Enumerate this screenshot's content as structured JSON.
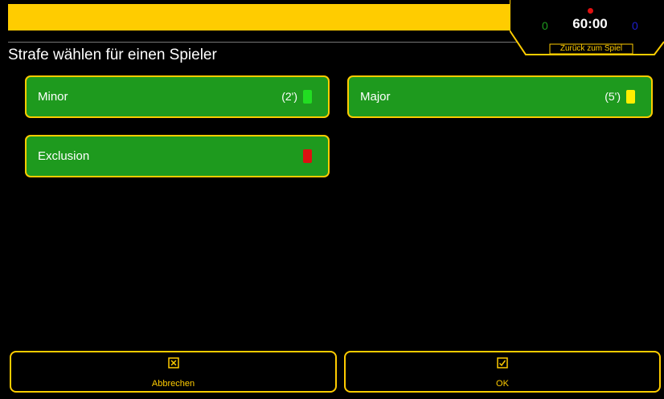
{
  "scoreboard": {
    "home_score": "0",
    "time": "60:00",
    "away_score": "0",
    "back_label": "Zurück zum Spiel"
  },
  "title": "Strafe wählen für einen Spieler",
  "penalties": [
    {
      "label": "Minor",
      "duration": "(2')",
      "card_color": "#22dd22"
    },
    {
      "label": "Major",
      "duration": "(5')",
      "card_color": "#ffee00"
    },
    {
      "label": "Exclusion",
      "duration": "",
      "card_color": "#dd1111"
    }
  ],
  "footer": {
    "cancel_label": "Abbrechen",
    "ok_label": "OK"
  },
  "colors": {
    "accent": "#ffcc00",
    "button_green": "#1e9a1e",
    "background": "#000000"
  },
  "icons": {
    "cancel": "x-box-icon",
    "ok": "check-box-icon"
  }
}
